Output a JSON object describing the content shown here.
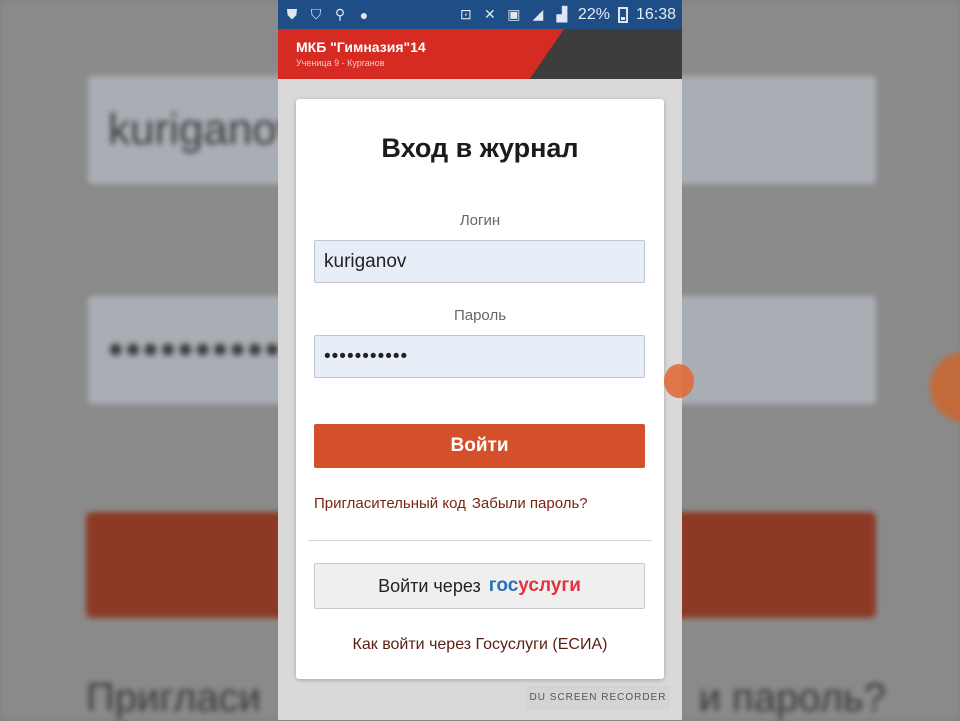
{
  "status_bar": {
    "battery": "22%",
    "time": "16:38"
  },
  "site": {
    "name": "МКБ \"Гимназия\"14",
    "subtitle": "Ученица 9 - Курганов"
  },
  "login_form": {
    "title": "Вход в журнал",
    "login_label": "Логин",
    "login_value": "kuriganov",
    "password_label": "Пароль",
    "password_value": "•••••••••••",
    "submit_label": "Войти",
    "invite_link": "Пригласительный код",
    "forgot_link": "Забыли пароль?",
    "gosuslugi_button_prefix": "Войти через",
    "gosuslugi_logo_blue": "гос",
    "gosuslugi_logo_red": "услуги",
    "help_link": "Как войти через Госуслуги (ЕСИА)"
  },
  "background": {
    "login_text": "kuriganov",
    "password_text": "••••••••••",
    "links_left": "Пригласи",
    "links_right": "и пароль?"
  },
  "watermark": "DU SCREEN RECORDER",
  "colors": {
    "status_bar": "#1f4d86",
    "header_red": "#d52b22",
    "primary_button": "#d4502b",
    "gos_blue": "#2d6fb7",
    "gos_red": "#e0333f"
  }
}
